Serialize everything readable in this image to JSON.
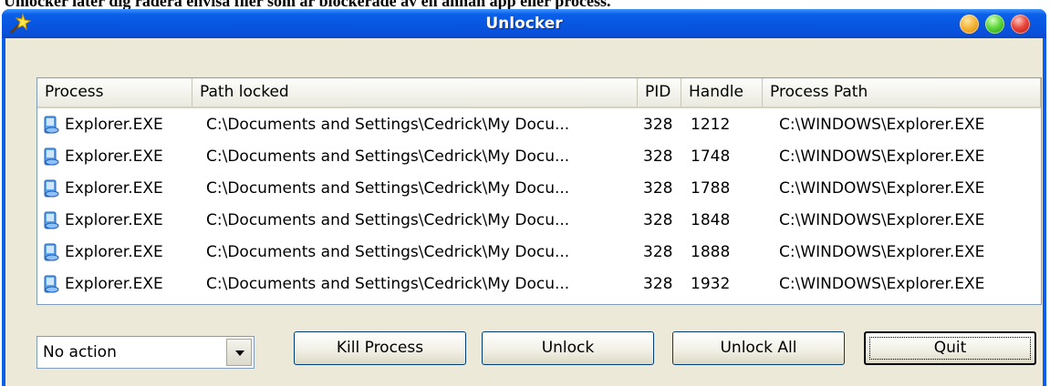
{
  "caption": "Unlocker låter dig radera envisa filer som är blockerade av en annan app eller process.",
  "window": {
    "title": "Unlocker"
  },
  "list": {
    "columns": [
      "Process",
      "Path locked",
      "PID",
      "Handle",
      "Process Path"
    ],
    "rows": [
      [
        "Explorer.EXE",
        "C:\\Documents and Settings\\Cedrick\\My Docu...",
        "328",
        "1212",
        "C:\\WINDOWS\\Explorer.EXE"
      ],
      [
        "Explorer.EXE",
        "C:\\Documents and Settings\\Cedrick\\My Docu...",
        "328",
        "1748",
        "C:\\WINDOWS\\Explorer.EXE"
      ],
      [
        "Explorer.EXE",
        "C:\\Documents and Settings\\Cedrick\\My Docu...",
        "328",
        "1788",
        "C:\\WINDOWS\\Explorer.EXE"
      ],
      [
        "Explorer.EXE",
        "C:\\Documents and Settings\\Cedrick\\My Docu...",
        "328",
        "1848",
        "C:\\WINDOWS\\Explorer.EXE"
      ],
      [
        "Explorer.EXE",
        "C:\\Documents and Settings\\Cedrick\\My Docu...",
        "328",
        "1888",
        "C:\\WINDOWS\\Explorer.EXE"
      ],
      [
        "Explorer.EXE",
        "C:\\Documents and Settings\\Cedrick\\My Docu...",
        "328",
        "1932",
        "C:\\WINDOWS\\Explorer.EXE"
      ]
    ]
  },
  "controls": {
    "action_select_value": "No action",
    "kill_label": "Kill Process",
    "unlock_label": "Unlock",
    "unlock_all_label": "Unlock All",
    "quit_label": "Quit"
  },
  "icons": {
    "app": "wand-icon",
    "process": "explorer-process-icon"
  },
  "colors": {
    "titlebar": "#0a5fe8",
    "client": "#ece9d8"
  }
}
